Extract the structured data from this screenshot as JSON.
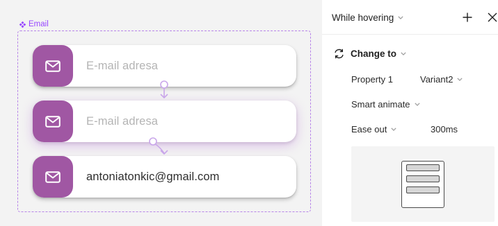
{
  "canvas": {
    "frame_label": "Email",
    "fields": [
      {
        "text": "E-mail adresa",
        "state": "placeholder",
        "icon": "mail-icon"
      },
      {
        "text": "E-mail adresa",
        "state": "placeholder",
        "icon": "mail-icon"
      },
      {
        "text": "antoniatonkic@gmail.com",
        "state": "filled",
        "icon": "mail-icon"
      }
    ]
  },
  "panel": {
    "trigger": "While hovering",
    "action": "Change to",
    "property_label": "Property 1",
    "property_value": "Variant2",
    "animation": "Smart animate",
    "easing": "Ease out",
    "duration": "300ms"
  },
  "colors": {
    "accent_purple": "#9747ff",
    "icon_tile": "#a057a3",
    "placeholder_text": "#b4b4b4",
    "filled_text": "#2e2e2e",
    "canvas_bg": "#f3f3f3"
  }
}
